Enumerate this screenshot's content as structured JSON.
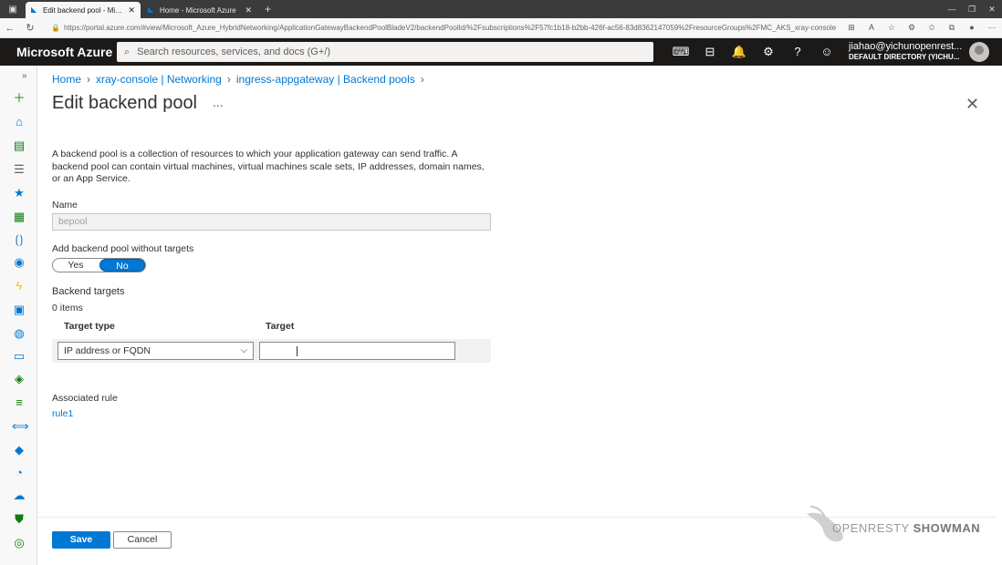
{
  "browser": {
    "tabs": [
      {
        "title": "Edit backend pool - Microsoft Azure",
        "active": true
      },
      {
        "title": "Home - Microsoft Azure",
        "active": false
      }
    ],
    "url": "https://portal.azure.com/#view/Microsoft_Azure_HybridNetworking/ApplicationGatewayBackendPoolBladeV2/backendPoolId/%2Fsubscriptions%2F57fc1b18-b2bb-426f-ac56-83d8362147059%2FresourceGroups%2FMC_AKS_xray-console_south..."
  },
  "header": {
    "brand": "Microsoft Azure",
    "search_placeholder": "Search resources, services, and docs (G+/)",
    "account_user": "jiahao@yichunopenrest...",
    "account_directory": "DEFAULT DIRECTORY (YICHU..."
  },
  "breadcrumb": [
    "Home",
    "xray-console | Networking",
    "ingress-appgateway | Backend pools"
  ],
  "page": {
    "title": "Edit backend pool",
    "more": "...",
    "description": "A backend pool is a collection of resources to which your application gateway can send traffic. A backend pool can contain virtual machines, virtual machines scale sets, IP addresses, domain names, or an App Service."
  },
  "form": {
    "name_label": "Name",
    "name_value": "bepool",
    "no_targets_label": "Add backend pool without targets",
    "toggle_yes": "Yes",
    "toggle_no": "No",
    "toggle_selected": "No",
    "backend_targets_label": "Backend targets",
    "items_count": "0 items",
    "col_target_type": "Target type",
    "col_target": "Target",
    "target_type_value": "IP address or FQDN",
    "target_value": "",
    "associated_rule_label": "Associated rule",
    "associated_rule_link": "rule1"
  },
  "footer": {
    "save": "Save",
    "cancel": "Cancel"
  },
  "watermark": {
    "part1": "OPENRESTY",
    "part2": "SHOWMAN"
  },
  "colors": {
    "accent": "#0078d4",
    "header_bg": "#1b1a19"
  }
}
